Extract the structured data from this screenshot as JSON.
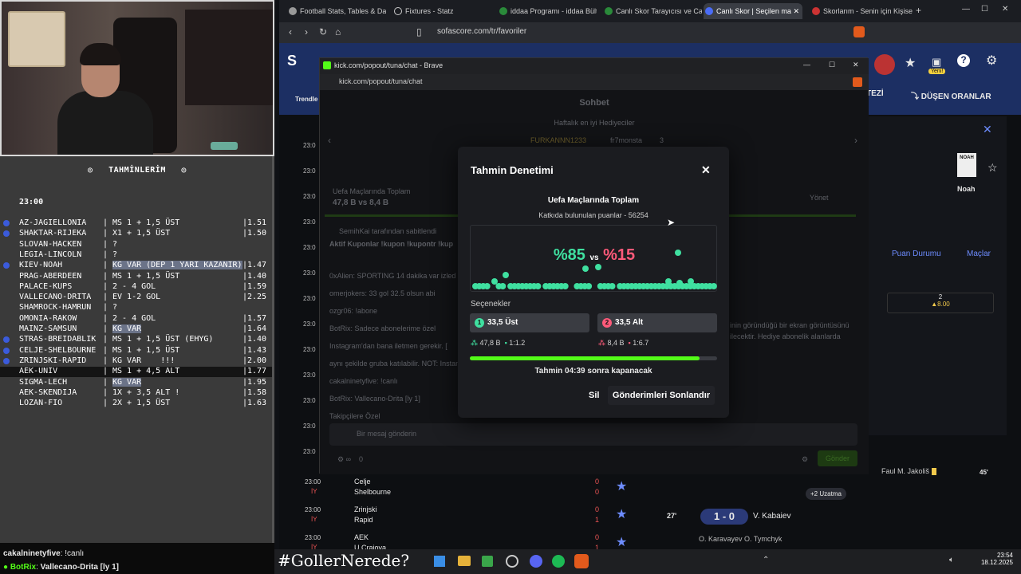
{
  "colors": {
    "kick_green": "#53fc18",
    "accent_blue": "#3b5bdb",
    "sofascore_blue": "#1c2f63"
  },
  "predictions_panel": {
    "title": "TAHMİNLERİM",
    "time": "23:00",
    "rows": [
      {
        "match": "AZ-JAGIELLONIA",
        "pick": "MS 1 + 1,5 ÜST",
        "odds": "1.51",
        "marked": true,
        "highlight_kv": false,
        "selected": false
      },
      {
        "match": "SHAKTAR-RIJEKA",
        "pick": "X1 + 1,5 ÜST",
        "odds": "1.50",
        "marked": true,
        "highlight_kv": false,
        "selected": false
      },
      {
        "match": "SLOVAN-HACKEN",
        "pick": "?",
        "odds": "",
        "marked": false,
        "highlight_kv": false,
        "selected": false
      },
      {
        "match": "LEGIA-LINCOLN",
        "pick": "?",
        "odds": "",
        "marked": false,
        "highlight_kv": false,
        "selected": false
      },
      {
        "match": "KIEV-NOAH",
        "pick": "KG VAR (DEP 1 YARI KAZANIR)",
        "odds": "1.47",
        "marked": true,
        "highlight_kv": true,
        "selected": false
      },
      {
        "match": "PRAG-ABERDEEN",
        "pick": "MS 1 + 1,5 ÜST",
        "odds": "1.40",
        "marked": false,
        "highlight_kv": false,
        "selected": false
      },
      {
        "match": "PALACE-KUPS",
        "pick": "2 - 4 GOL",
        "odds": "1.59",
        "marked": false,
        "highlight_kv": false,
        "selected": false
      },
      {
        "match": "VALLECANO-DRITA",
        "pick": "EV 1-2 GOL",
        "odds": "2.25",
        "marked": false,
        "highlight_kv": false,
        "selected": false
      },
      {
        "match": "SHAMROCK-HAMRUN",
        "pick": "?",
        "odds": "",
        "marked": false,
        "highlight_kv": false,
        "selected": false
      },
      {
        "match": "OMONIA-RAKOW",
        "pick": "2 - 4 GOL",
        "odds": "1.57",
        "marked": false,
        "highlight_kv": false,
        "selected": false
      },
      {
        "match": "MAINZ-SAMSUN",
        "pick": "KG VAR",
        "odds": "1.64",
        "marked": false,
        "highlight_kv": true,
        "selected": false
      },
      {
        "match": "STRAS-BREIDABLIK",
        "pick": "MS 1 + 1,5 ÜST (EHYG)",
        "odds": "1.40",
        "marked": true,
        "highlight_kv": false,
        "selected": false
      },
      {
        "match": "CELJE-SHELBOURNE",
        "pick": "MS 1 + 1,5 ÜST",
        "odds": "1.43",
        "marked": true,
        "highlight_kv": false,
        "selected": false
      },
      {
        "match": "ZRINJSKI-RAPID",
        "pick": "KG VAR    !!!",
        "odds": "2.00",
        "marked": true,
        "highlight_kv": false,
        "selected": false
      },
      {
        "match": "AEK-UNIV",
        "pick": "MS 1 + 4,5 ALT",
        "odds": "1.77",
        "marked": false,
        "highlight_kv": false,
        "selected": true
      },
      {
        "match": "SIGMA-LECH",
        "pick": "KG VAR",
        "odds": "1.95",
        "marked": false,
        "highlight_kv": true,
        "selected": false
      },
      {
        "match": "AEK-SKENDIJA",
        "pick": "1X + 3,5 ALT !",
        "odds": "1.58",
        "marked": false,
        "highlight_kv": false,
        "selected": false
      },
      {
        "match": "LOZAN-FIO",
        "pick": "2X + 1,5 ÜST",
        "odds": "1.63",
        "marked": false,
        "highlight_kv": false,
        "selected": false
      }
    ]
  },
  "stream_chat": [
    {
      "user": "cakalninetyfive",
      "text": "!canlı"
    },
    {
      "user": "BotRix",
      "text": "Vallecano-Drita [ly 1]"
    }
  ],
  "browser": {
    "tabs": [
      {
        "label": "Football Stats, Tables & Dat",
        "active": false
      },
      {
        "label": "Fixtures - Statz",
        "active": false
      },
      {
        "label": "iddaa Programı - iddaa Bült",
        "active": false
      },
      {
        "label": "Canlı Skor Tarayıcısı ve Canl",
        "active": false
      },
      {
        "label": "Canlı Skor | Seçilen ma",
        "active": true
      },
      {
        "label": "Skorlarım - Senin için Kişise",
        "active": false
      }
    ],
    "url": "sofascore.com/tr/favoriler"
  },
  "sofascore": {
    "nav_trending": "Trendle",
    "nav_right": "DÜŞEN ORANLAR",
    "nav_tezi": "TEZİ",
    "team_name": "Noah",
    "team_logo_text": "NOAH",
    "new_badge": "Yeni!",
    "tab_standings": "Puan Durumu",
    "tab_matches": "Maçlar",
    "odds_label": "2",
    "odds_value": "8.00",
    "player": "Faul M. Jakoliš",
    "minute": "45'",
    "extra_time": "+2 Uzatma",
    "goal_minute": "27'",
    "goal_score": "1 - 0",
    "goal_player": "V. Kabaiev",
    "sub_player": "O. Karavayev O. Tymchyk",
    "matches": [
      {
        "time": "23:00",
        "status": "İY",
        "home": "Celje",
        "away": "Shelbourne",
        "hs": "0",
        "as": "0"
      },
      {
        "time": "23:00",
        "status": "İY",
        "home": "Zrinjski",
        "away": "Rapid",
        "hs": "0",
        "as": "1"
      },
      {
        "time": "23:00",
        "status": "İY",
        "home": "AEK",
        "away": "U Craiova",
        "hs": "0",
        "as": "1"
      }
    ],
    "left_times": [
      "23:0",
      "23:0",
      "23:0",
      "23:0",
      "23:0",
      "23:0",
      "23:0",
      "23:0",
      "23:0",
      "23:0",
      "23:0",
      "23:0",
      "23:0"
    ]
  },
  "kick_popup": {
    "window_title": "kick.com/popout/tuna/chat - Brave",
    "address": "kick.com/popout/tuna/chat",
    "chat_header": "Sohbet",
    "gifters_title": "Haftalık en iyi Hediyeciler",
    "gifter1": "FURKANNN1233",
    "gifter2": "fr7monsta",
    "gifter2_count": "3",
    "pinned_title": "Uefa Maçlarında Toplam",
    "pinned_a": "47,8 B",
    "pinned_vs": "vs",
    "pinned_b": "8,4 B",
    "manage": "Yönet",
    "pinned_by": "SemihKai tarafından sabitlendi",
    "pinned_msg": "Aktif Kuponlar !kupon !kupontr !kup",
    "messages": [
      "0xAlien: SPORTING 14 dakika var izled",
      "omerjokers: 33 gol 32.5 olsun abi",
      "ozgr06: !abone",
      "BotRix: Sadece abonelerime özel",
      "Instagram'dan bana iletmen gerekir. [",
      "aynı şekilde gruba katılabilir. NOT: Instan",
      "cakalninetyfive: !canlı",
      "BotRix: Vallecano-Drita [ly 1]",
      "Takipçilere Özel"
    ],
    "right_text_1": "inin göründüğü bir ekran görüntüsünü",
    "right_text_2": "ilecektir. Hediye abonelik alanlarda",
    "input_placeholder": "Bir mesaj gönderin",
    "viewer_count": "0",
    "send": "Gönder"
  },
  "modal": {
    "title": "Tahmin Denetimi",
    "question": "Uefa Maçlarında Toplam",
    "points_text": "Katkıda bulunulan puanlar - 56254",
    "pct_a": "%85",
    "vs": "vs",
    "pct_b": "%15",
    "options_label": "Seçenekler",
    "option1": {
      "num": "1",
      "label": "33,5 Üst",
      "points": "47,8 B",
      "ratio": "1:1.2"
    },
    "option2": {
      "num": "2",
      "label": "33,5 Alt",
      "points": "8,4 B",
      "ratio": "1:6.7"
    },
    "progress": 0.93,
    "countdown": "Tahmin 04:39 sonra kapanacak",
    "delete": "Sil",
    "end": "Gönderimleri Sonlandır"
  },
  "taskbar": {
    "hashtag": "#GollerNerede?",
    "time": "23:54",
    "date": "18.12.2025"
  }
}
